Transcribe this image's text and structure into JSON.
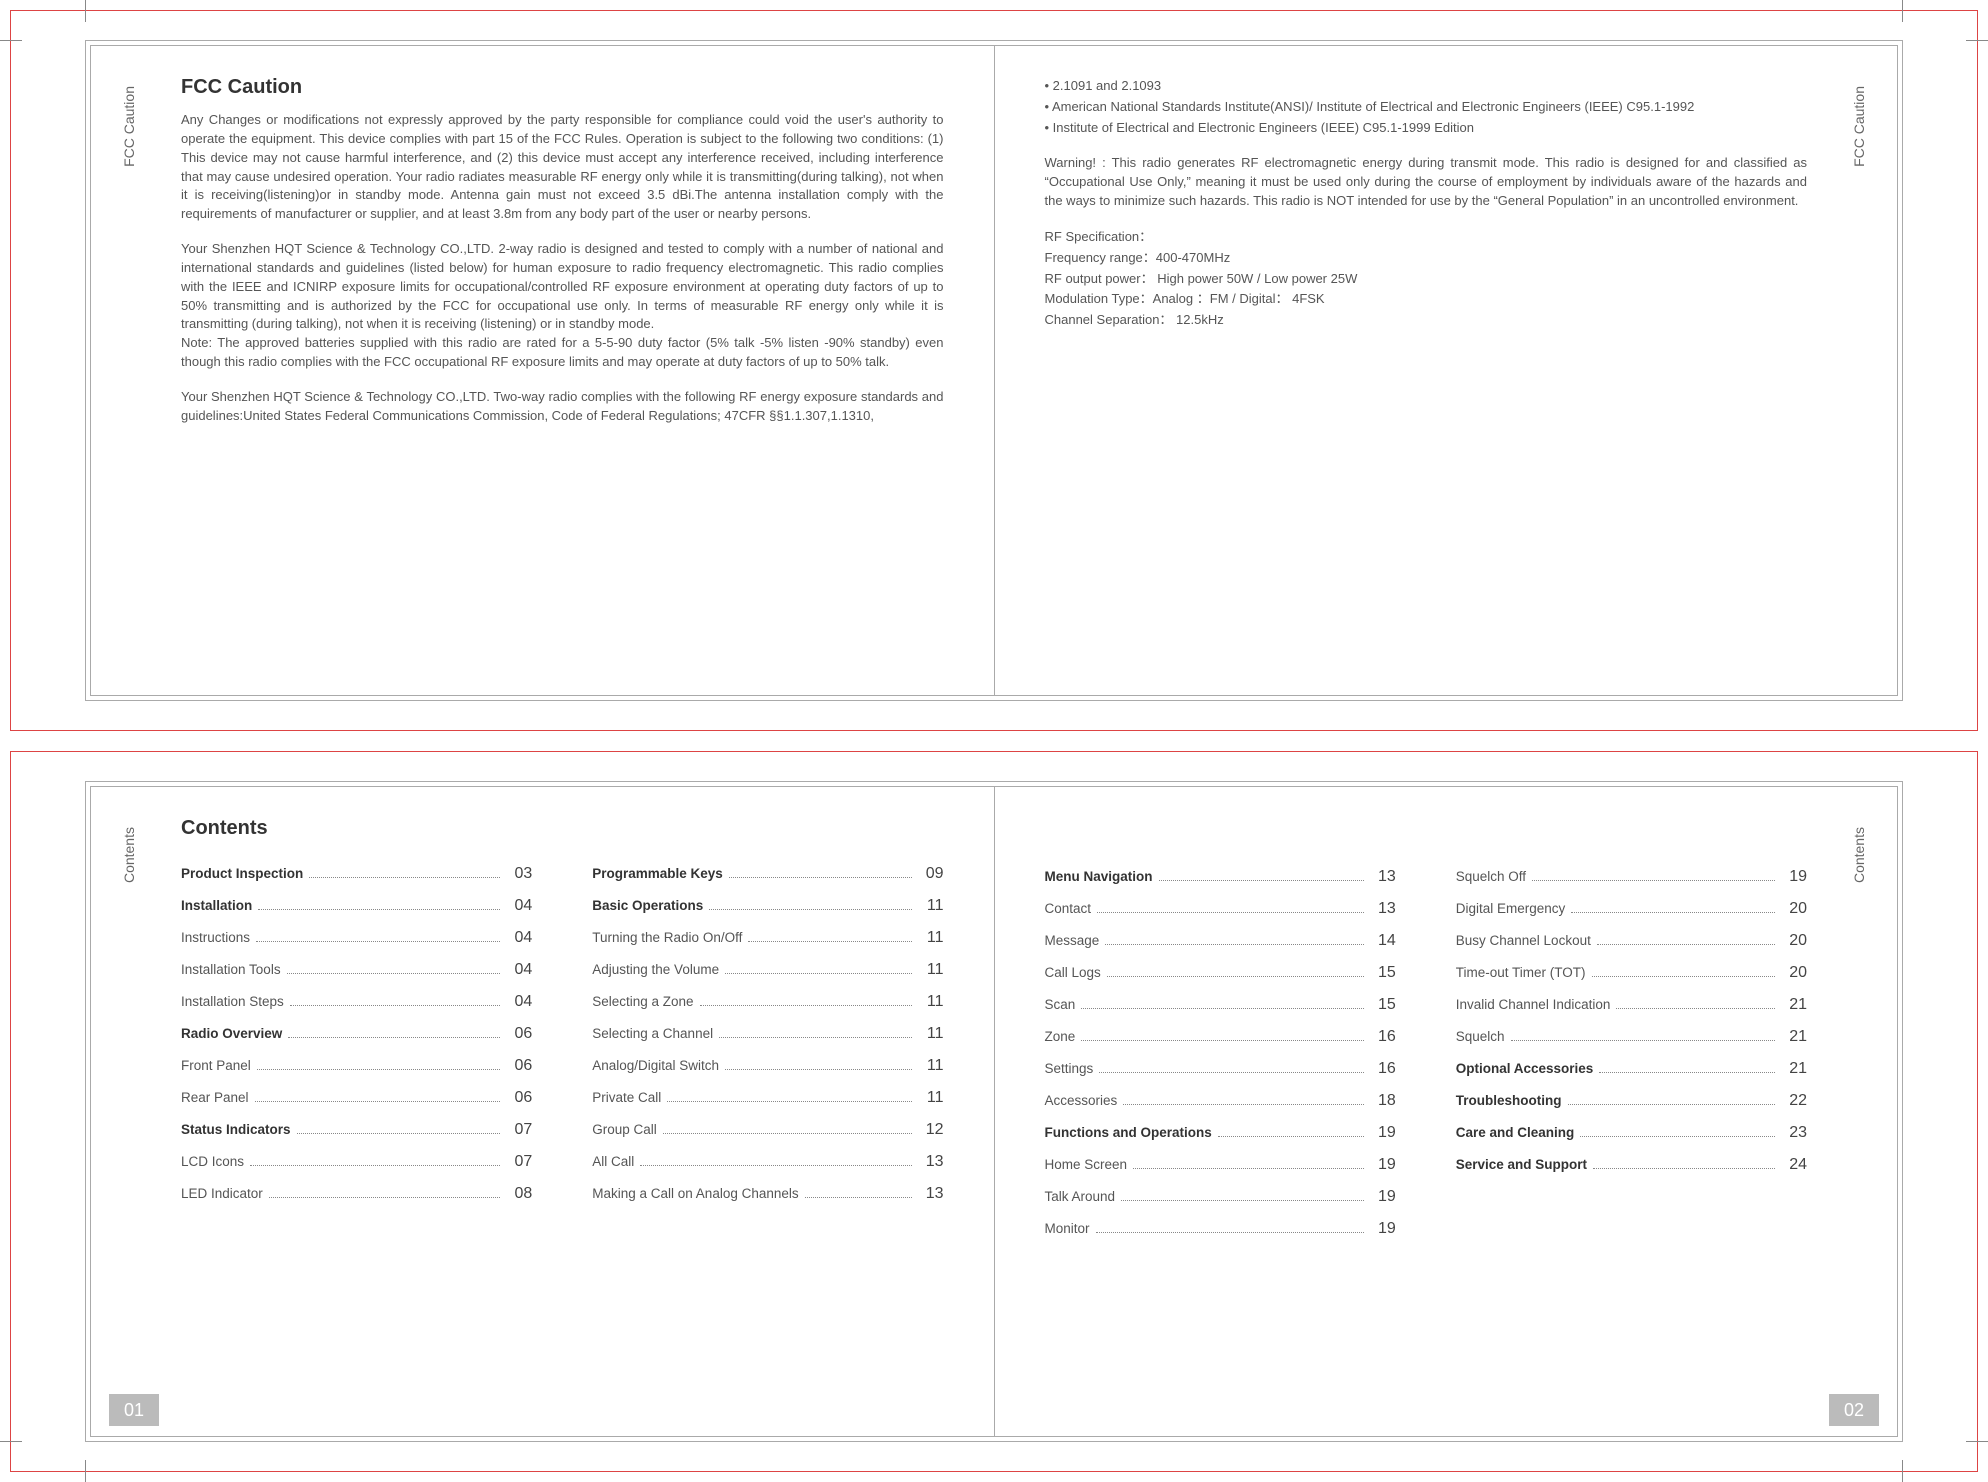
{
  "top": {
    "side_tab": "FCC  Caution",
    "left": {
      "title": "FCC Caution",
      "paras": [
        "Any Changes or modifications not expressly approved by the party responsible for compliance could void the user's  authority to operate the equipment. This device complies with part 15 of the FCC Rules. Operation is subject to the following two conditions: (1) This device may not cause harmful interference,  and (2) this device must accept any interference received, including interference that may cause undesired operation. Your radio radiates measurable RF energy only while it is transmitting(during talking), not when it is receiving(listening)or in standby mode. Antenna gain must not exceed 3.5 dBi.The antenna installation comply with the requirements of manufacturer or supplier, and at least 3.8m from any body part of the user or nearby persons.",
        "Your Shenzhen HQT Science & Technology CO.,LTD.  2-way radio is designed and tested to comply with a number of national and international standards and guidelines (listed below) for human exposure to radio frequency electromagnetic. This radio complies with the IEEE and ICNIRP exposure limits for occupational/controlled RF exposure environment at operating duty factors of up to 50% transmitting and is authorized by the FCC for occupational use only. In terms of measurable RF energy only while it is transmitting (during talking), not when it is receiving (listening) or in standby mode.\nNote: The approved batteries supplied with this radio are rated for a 5-5-90 duty factor (5% talk -5% listen -90% standby) even though this radio complies with the FCC occupational RF exposure limits and may operate at duty factors of up to 50% talk.",
        "Your Shenzhen HQT Science & Technology CO.,LTD. Two-way radio complies with the following RF energy exposure standards and guidelines:United States Federal Communications Commission, Code of Federal Regulations; 47CFR §§1.1.307,1.1310,"
      ]
    },
    "right": {
      "bullets": [
        "2.1091 and 2.1093",
        "American National Standards Institute(ANSI)/ Institute of Electrical and Electronic Engineers (IEEE) C95.1-1992",
        "Institute of Electrical and Electronic Engineers (IEEE) C95.1-1999 Edition"
      ],
      "warning": "Warning! : This  radio generates RF electromagnetic energy during transmit mode. This radio is designed for and classified as “Occupational Use Only,” meaning it must be used only during the course of employment by individuals aware of the hazards and the ways to minimize such hazards. This radio is NOT intended for use by the “General Population” in an uncontrolled environment.",
      "specs": [
        "RF Specification：",
        "Frequency range：400-470MHz",
        "RF output power： High power 50W / Low power 25W",
        "Modulation Type：Analog ：FM / Digital： 4FSK",
        "Channel Separation： 12.5kHz"
      ]
    }
  },
  "bottom": {
    "side_tab": "Contents",
    "title": "Contents",
    "page_left": "01",
    "page_right": "02",
    "cols": [
      [
        {
          "label": "Product Inspection",
          "page": "03",
          "bold": true
        },
        {
          "label": "Installation",
          "page": "04",
          "bold": true
        },
        {
          "label": "Instructions",
          "page": "04"
        },
        {
          "label": "Installation Tools",
          "page": "04"
        },
        {
          "label": "Installation Steps",
          "page": "04"
        },
        {
          "label": "Radio Overview",
          "page": "06",
          "bold": true
        },
        {
          "label": "Front Panel",
          "page": "06"
        },
        {
          "label": "Rear Panel",
          "page": "06"
        },
        {
          "label": "Status Indicators",
          "page": "07",
          "bold": true
        },
        {
          "label": "LCD Icons",
          "page": "07"
        },
        {
          "label": "LED Indicator",
          "page": "08"
        }
      ],
      [
        {
          "label": "Programmable Keys",
          "page": "09",
          "bold": true
        },
        {
          "label": "Basic Operations",
          "page": "11",
          "bold": true
        },
        {
          "label": "Turning the Radio On/Off",
          "page": "11"
        },
        {
          "label": "Adjusting the Volume",
          "page": "11"
        },
        {
          "label": "Selecting a Zone",
          "page": "11"
        },
        {
          "label": "Selecting a Channel",
          "page": "11"
        },
        {
          "label": "Analog/Digital Switch",
          "page": "11"
        },
        {
          "label": "Private Call",
          "page": "11"
        },
        {
          "label": "Group Call",
          "page": "12"
        },
        {
          "label": "All Call",
          "page": "13"
        },
        {
          "label": "Making a Call on Analog Channels",
          "page": "13"
        }
      ],
      [
        {
          "label": "Menu Navigation",
          "page": "13",
          "bold": true
        },
        {
          "label": "Contact",
          "page": "13"
        },
        {
          "label": "Message",
          "page": "14"
        },
        {
          "label": "Call Logs",
          "page": "15"
        },
        {
          "label": "Scan",
          "page": "15"
        },
        {
          "label": "Zone",
          "page": "16"
        },
        {
          "label": "Settings",
          "page": "16"
        },
        {
          "label": "Accessories",
          "page": "18"
        },
        {
          "label": "Functions and Operations",
          "page": "19",
          "bold": true
        },
        {
          "label": "Home Screen",
          "page": "19"
        },
        {
          "label": "Talk Around",
          "page": "19"
        },
        {
          "label": "Monitor",
          "page": "19"
        }
      ],
      [
        {
          "label": "Squelch Off",
          "page": "19"
        },
        {
          "label": "Digital Emergency",
          "page": "20"
        },
        {
          "label": "Busy Channel Lockout",
          "page": "20"
        },
        {
          "label": "Time-out Timer (TOT)",
          "page": "20"
        },
        {
          "label": "Invalid Channel Indication",
          "page": "21"
        },
        {
          "label": "Squelch",
          "page": "21"
        },
        {
          "label": "Optional Accessories",
          "page": "21",
          "bold": true
        },
        {
          "label": "Troubleshooting",
          "page": "22",
          "bold": true
        },
        {
          "label": "Care and Cleaning",
          "page": "23",
          "bold": true
        },
        {
          "label": "Service and Support",
          "page": "24",
          "bold": true
        }
      ]
    ]
  }
}
